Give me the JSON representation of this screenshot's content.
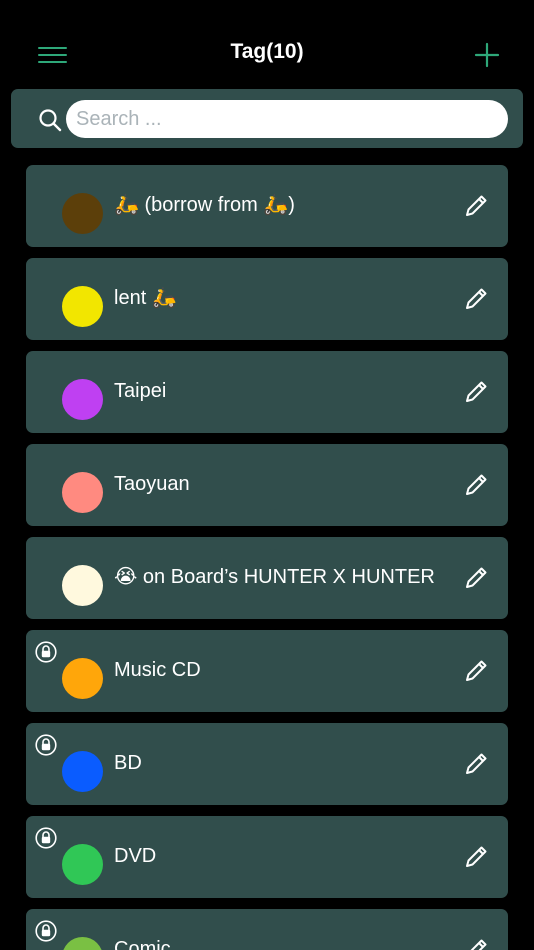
{
  "nav": {
    "title": "Tag(10)",
    "menu_icon": "hamburger-menu-icon",
    "add_icon": "plus-icon",
    "accent_color": "#2ea879"
  },
  "search": {
    "placeholder": "Search ...",
    "value": "",
    "icon": "search-icon"
  },
  "tags": [
    {
      "label": "🛵 (borrow from 🛵)",
      "color": "#5c3f0a",
      "locked": false
    },
    {
      "label": "lent 🛵",
      "color": "#f2e600",
      "locked": false
    },
    {
      "label": "Taipei",
      "color": "#bf40f2",
      "locked": false
    },
    {
      "label": "Taoyuan",
      "color": "#ff8a80",
      "locked": false
    },
    {
      "label": "😭 on Board’s HUNTER X HUNTER",
      "color": "#fff9de",
      "locked": false
    },
    {
      "label": "Music CD",
      "color": "#ffa60a",
      "locked": true
    },
    {
      "label": "BD",
      "color": "#0a5cff",
      "locked": true
    },
    {
      "label": "DVD",
      "color": "#30c756",
      "locked": true
    },
    {
      "label": "Comic",
      "color": "#7ac043",
      "locked": true
    }
  ],
  "row_colors": {
    "background": "#314e4c",
    "page": "#000000"
  }
}
